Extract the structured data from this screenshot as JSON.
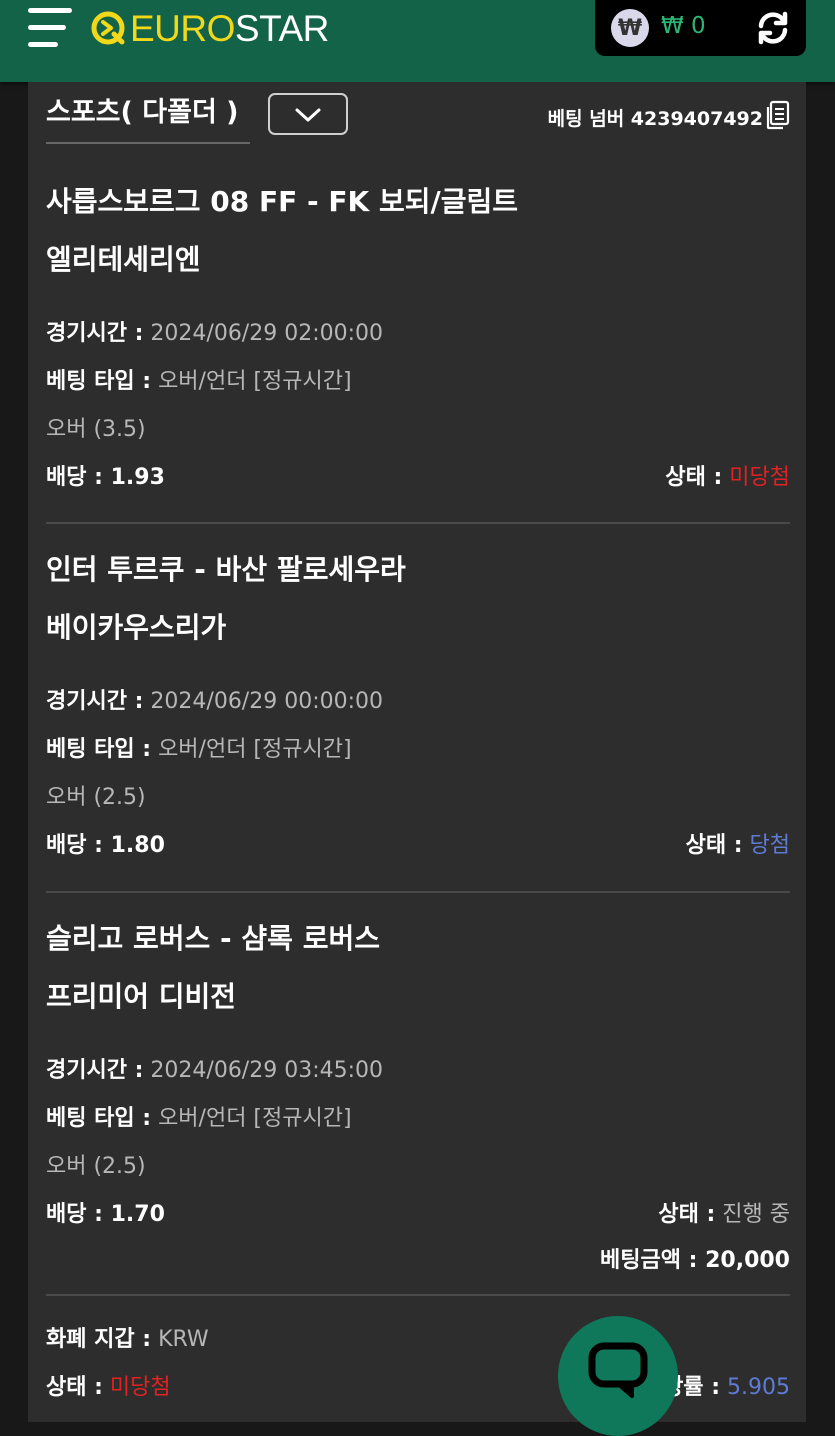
{
  "header": {
    "brand_euro": "EURO",
    "brand_star": "STAR",
    "currency_symbol": "₩",
    "balance": "₩ 0"
  },
  "slip": {
    "category": "스포츠( 다폴더 )",
    "bet_number": "베팅 넘버 4239407492",
    "bets": [
      {
        "match": "사릅스보르그 08 FF - FK 보되/글림트",
        "league": "엘리테세리엔",
        "time_label": "경기시간 :",
        "time": " 2024/06/29 02:00:00",
        "type_label": "베팅 타입 :",
        "type": " 오버/언더 [정규시간]",
        "pick": "오버 (3.5)",
        "odds_label": "배당 :",
        "odds": " 1.93",
        "status_label": "상태 :",
        "status": " 미당첨"
      },
      {
        "match": "인터 투르쿠 - 바산 팔로세우라",
        "league": "베이카우스리가",
        "time_label": "경기시간 :",
        "time": " 2024/06/29 00:00:00",
        "type_label": "베팅 타입 :",
        "type": " 오버/언더 [정규시간]",
        "pick": "오버 (2.5)",
        "odds_label": "배당 :",
        "odds": " 1.80",
        "status_label": "상태 :",
        "status": " 당첨"
      },
      {
        "match": "슬리고 로버스 - 샴록 로버스",
        "league": "프리미어 디비전",
        "time_label": "경기시간 :",
        "time": " 2024/06/29 03:45:00",
        "type_label": "베팅 타입 :",
        "type": " 오버/언더 [정규시간]",
        "pick": "오버 (2.5)",
        "odds_label": "배당 :",
        "odds": " 1.70",
        "status_label": "상태 :",
        "status": " 진행 중"
      }
    ],
    "stake_label": "베팅금액 :",
    "stake": " 20,000",
    "summary": {
      "wallet_label": "화폐 지갑 :",
      "wallet": " KRW",
      "status_label": "상태 :",
      "status": " 미당첨",
      "total_odds_label": "배당률 :",
      "total_odds": " 5.905"
    }
  },
  "colors": {
    "header_green": "#136349",
    "lost_red": "#e22222",
    "won_blue": "#5e7bd6",
    "balance_green": "#2bb673",
    "logo_yellow": "#f2d81a"
  }
}
